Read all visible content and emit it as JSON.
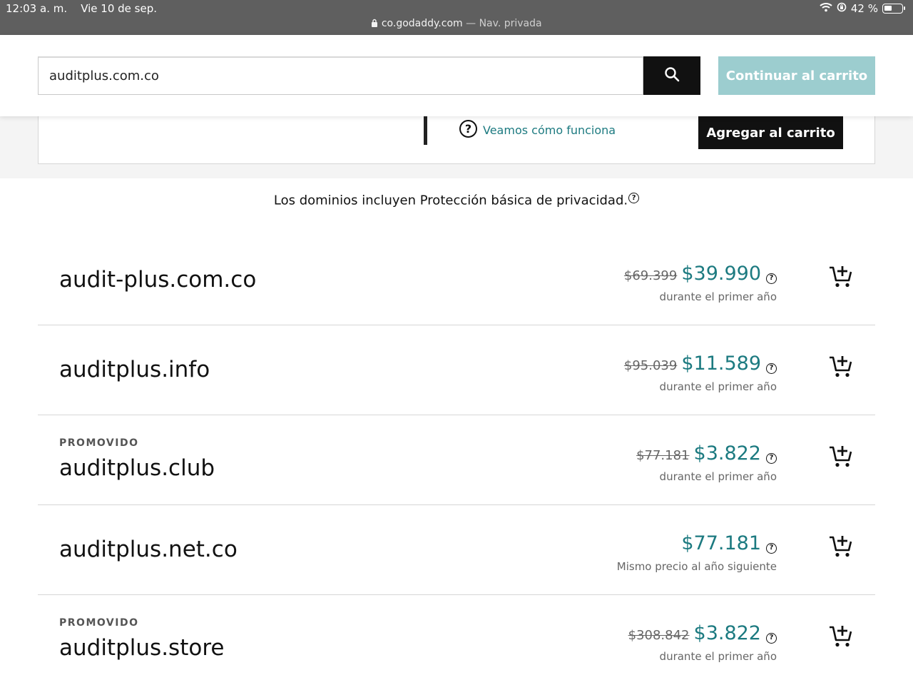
{
  "status": {
    "time": "12:03 a. m.",
    "date": "Vie 10 de sep.",
    "url": "co.godaddy.com",
    "private_label": "— Nav. privada",
    "battery": "42 %"
  },
  "search": {
    "value": "auditplus.com.co",
    "continue_label": "Continuar al carrito"
  },
  "card": {
    "help_symbol": "?",
    "how_label": "Veamos cómo funciona",
    "add_label": "Agregar al carrito"
  },
  "privacy_note": "Los dominios incluyen Protección básica de privacidad.",
  "qmark": "?",
  "results": [
    {
      "promo": "",
      "name": "audit-plus",
      "tld": ".com.co",
      "old_price": "$69.399",
      "price": "$39.990",
      "note": "durante el primer año"
    },
    {
      "promo": "",
      "name": "auditplus",
      "tld": ".info",
      "old_price": "$95.039",
      "price": "$11.589",
      "note": "durante el primer año"
    },
    {
      "promo": "PROMOVIDO",
      "name": "auditplus",
      "tld": ".club",
      "old_price": "$77.181",
      "price": "$3.822",
      "note": "durante el primer año"
    },
    {
      "promo": "",
      "name": "auditplus",
      "tld": ".net.co",
      "old_price": "",
      "price": "$77.181",
      "note": "Mismo precio al año siguiente"
    },
    {
      "promo": "PROMOVIDO",
      "name": "auditplus",
      "tld": ".store",
      "old_price": "$308.842",
      "price": "$3.822",
      "note": "durante el primer año"
    }
  ],
  "colors": {
    "accent": "#1c7a80",
    "cart_button": "#9ccdcf",
    "dark_button": "#111111"
  }
}
